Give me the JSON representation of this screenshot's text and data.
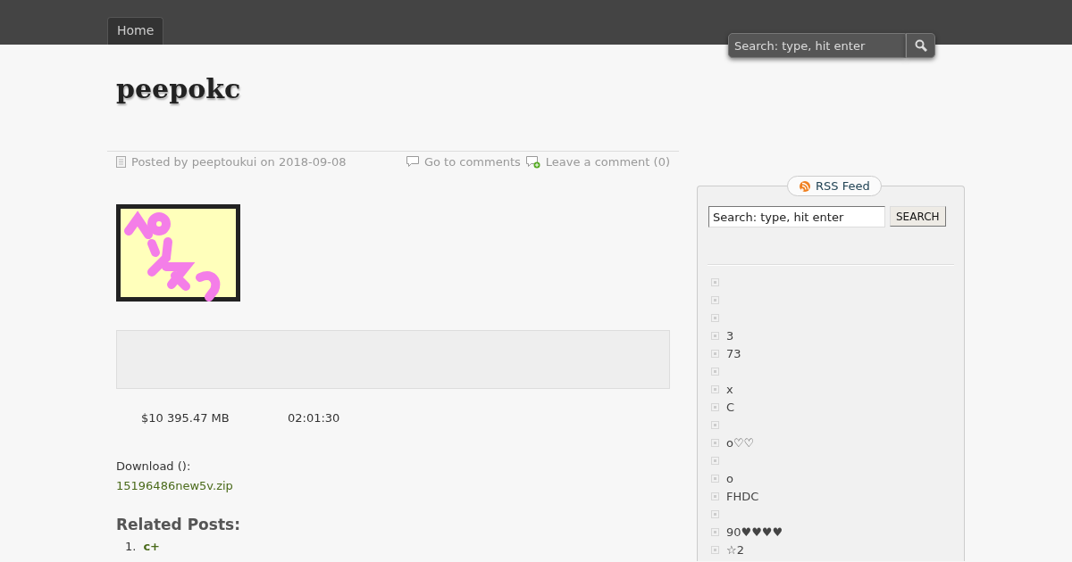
{
  "nav": {
    "tabs": [
      {
        "label": "Home",
        "selected": true
      }
    ],
    "search": {
      "placeholder": "Search: type, hit enter"
    }
  },
  "site_title": "peepokc",
  "post": {
    "meta": "Posted by peeptoukui on 2018-09-08",
    "comments_link": "Go to comments",
    "leave_comment": "Leave a comment (0)",
    "info": [
      "$10 395.47 MB",
      "02:01:30"
    ],
    "download_label": "Download ():",
    "download_link": "15196486new5v.zip",
    "related_heading": "Related Posts:",
    "related": [
      {
        "number": "1.",
        "title": "c+"
      }
    ]
  },
  "sidebar": {
    "rss": "RSS Feed",
    "search": {
      "value": "Search: type, hit enter",
      "button": "SEARCH"
    },
    "items": [
      {
        "kind": "empty"
      },
      {
        "kind": "empty"
      },
      {
        "kind": "empty"
      },
      {
        "kind": "text",
        "text": "3"
      },
      {
        "kind": "text",
        "text": "73"
      },
      {
        "kind": "empty"
      },
      {
        "kind": "text",
        "text": "x"
      },
      {
        "kind": "text",
        "text": "C"
      },
      {
        "kind": "empty"
      },
      {
        "kind": "text",
        "text": "o♡♡"
      },
      {
        "kind": "empty"
      },
      {
        "kind": "text",
        "text": "o"
      },
      {
        "kind": "text",
        "text": "FHDC"
      },
      {
        "kind": "empty"
      },
      {
        "kind": "text",
        "text": "90♥♥♥♥"
      },
      {
        "kind": "text",
        "text": "☆2"
      }
    ]
  }
}
